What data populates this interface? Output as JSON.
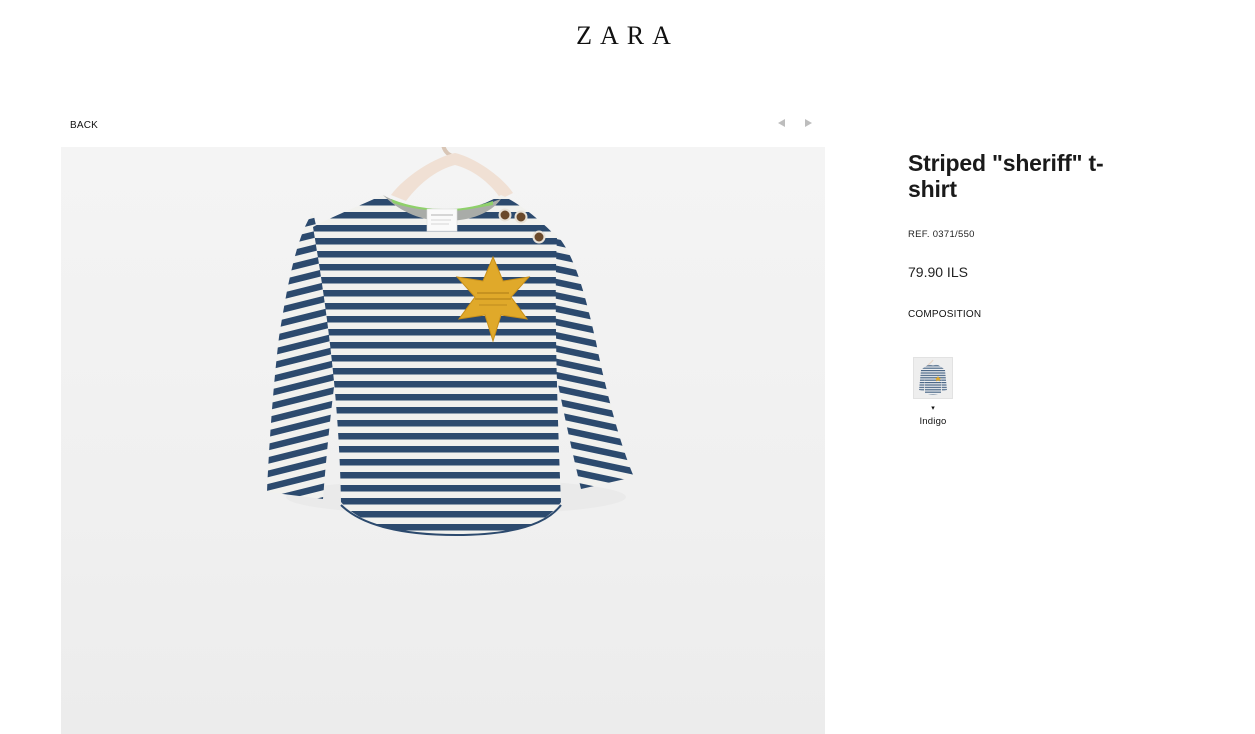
{
  "header": {
    "logo_text": "ZARA"
  },
  "nav": {
    "back_label": "BACK",
    "prev_icon": "triangle-left-icon",
    "next_icon": "triangle-right-icon"
  },
  "product": {
    "title": "Striped \"sheriff\" t-shirt",
    "ref": "REF. 0371/550",
    "price": "79.90 ILS",
    "composition_label": "COMPOSITION",
    "colors": [
      {
        "label": "Indigo",
        "caret": "▾"
      }
    ],
    "image_alt": "Blue and white striped long-sleeve t-shirt with yellow sheriff star on hanger"
  },
  "colors": {
    "stripe_navy": "#2c4a6e",
    "stripe_white": "#f1f1ee",
    "star_yellow": "#e0a92a",
    "collar_grey": "#a9aca8",
    "collar_green": "#8fd06b",
    "hanger": "#f0e0d4"
  }
}
